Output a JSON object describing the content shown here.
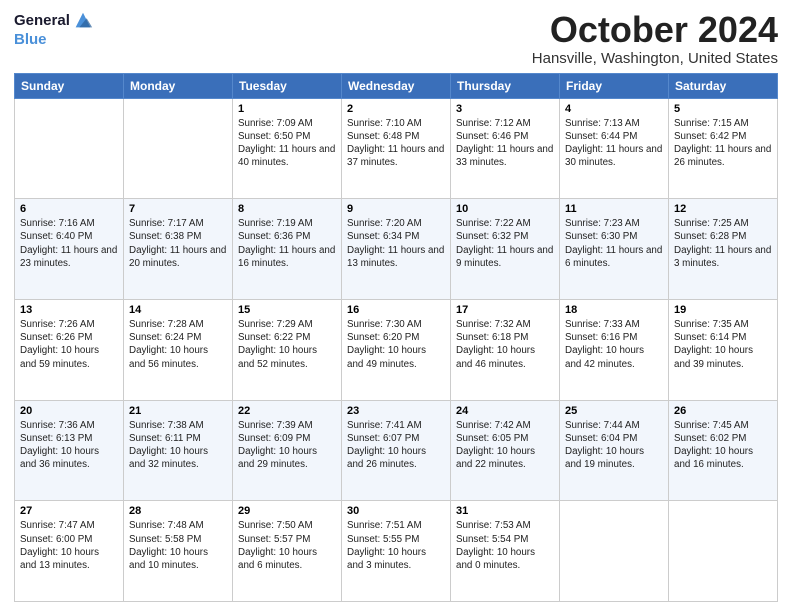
{
  "header": {
    "logo_line1": "General",
    "logo_line2": "Blue",
    "title": "October 2024",
    "subtitle": "Hansville, Washington, United States"
  },
  "weekdays": [
    "Sunday",
    "Monday",
    "Tuesday",
    "Wednesday",
    "Thursday",
    "Friday",
    "Saturday"
  ],
  "weeks": [
    [
      {
        "day": "",
        "info": ""
      },
      {
        "day": "",
        "info": ""
      },
      {
        "day": "1",
        "info": "Sunrise: 7:09 AM\nSunset: 6:50 PM\nDaylight: 11 hours and 40 minutes."
      },
      {
        "day": "2",
        "info": "Sunrise: 7:10 AM\nSunset: 6:48 PM\nDaylight: 11 hours and 37 minutes."
      },
      {
        "day": "3",
        "info": "Sunrise: 7:12 AM\nSunset: 6:46 PM\nDaylight: 11 hours and 33 minutes."
      },
      {
        "day": "4",
        "info": "Sunrise: 7:13 AM\nSunset: 6:44 PM\nDaylight: 11 hours and 30 minutes."
      },
      {
        "day": "5",
        "info": "Sunrise: 7:15 AM\nSunset: 6:42 PM\nDaylight: 11 hours and 26 minutes."
      }
    ],
    [
      {
        "day": "6",
        "info": "Sunrise: 7:16 AM\nSunset: 6:40 PM\nDaylight: 11 hours and 23 minutes."
      },
      {
        "day": "7",
        "info": "Sunrise: 7:17 AM\nSunset: 6:38 PM\nDaylight: 11 hours and 20 minutes."
      },
      {
        "day": "8",
        "info": "Sunrise: 7:19 AM\nSunset: 6:36 PM\nDaylight: 11 hours and 16 minutes."
      },
      {
        "day": "9",
        "info": "Sunrise: 7:20 AM\nSunset: 6:34 PM\nDaylight: 11 hours and 13 minutes."
      },
      {
        "day": "10",
        "info": "Sunrise: 7:22 AM\nSunset: 6:32 PM\nDaylight: 11 hours and 9 minutes."
      },
      {
        "day": "11",
        "info": "Sunrise: 7:23 AM\nSunset: 6:30 PM\nDaylight: 11 hours and 6 minutes."
      },
      {
        "day": "12",
        "info": "Sunrise: 7:25 AM\nSunset: 6:28 PM\nDaylight: 11 hours and 3 minutes."
      }
    ],
    [
      {
        "day": "13",
        "info": "Sunrise: 7:26 AM\nSunset: 6:26 PM\nDaylight: 10 hours and 59 minutes."
      },
      {
        "day": "14",
        "info": "Sunrise: 7:28 AM\nSunset: 6:24 PM\nDaylight: 10 hours and 56 minutes."
      },
      {
        "day": "15",
        "info": "Sunrise: 7:29 AM\nSunset: 6:22 PM\nDaylight: 10 hours and 52 minutes."
      },
      {
        "day": "16",
        "info": "Sunrise: 7:30 AM\nSunset: 6:20 PM\nDaylight: 10 hours and 49 minutes."
      },
      {
        "day": "17",
        "info": "Sunrise: 7:32 AM\nSunset: 6:18 PM\nDaylight: 10 hours and 46 minutes."
      },
      {
        "day": "18",
        "info": "Sunrise: 7:33 AM\nSunset: 6:16 PM\nDaylight: 10 hours and 42 minutes."
      },
      {
        "day": "19",
        "info": "Sunrise: 7:35 AM\nSunset: 6:14 PM\nDaylight: 10 hours and 39 minutes."
      }
    ],
    [
      {
        "day": "20",
        "info": "Sunrise: 7:36 AM\nSunset: 6:13 PM\nDaylight: 10 hours and 36 minutes."
      },
      {
        "day": "21",
        "info": "Sunrise: 7:38 AM\nSunset: 6:11 PM\nDaylight: 10 hours and 32 minutes."
      },
      {
        "day": "22",
        "info": "Sunrise: 7:39 AM\nSunset: 6:09 PM\nDaylight: 10 hours and 29 minutes."
      },
      {
        "day": "23",
        "info": "Sunrise: 7:41 AM\nSunset: 6:07 PM\nDaylight: 10 hours and 26 minutes."
      },
      {
        "day": "24",
        "info": "Sunrise: 7:42 AM\nSunset: 6:05 PM\nDaylight: 10 hours and 22 minutes."
      },
      {
        "day": "25",
        "info": "Sunrise: 7:44 AM\nSunset: 6:04 PM\nDaylight: 10 hours and 19 minutes."
      },
      {
        "day": "26",
        "info": "Sunrise: 7:45 AM\nSunset: 6:02 PM\nDaylight: 10 hours and 16 minutes."
      }
    ],
    [
      {
        "day": "27",
        "info": "Sunrise: 7:47 AM\nSunset: 6:00 PM\nDaylight: 10 hours and 13 minutes."
      },
      {
        "day": "28",
        "info": "Sunrise: 7:48 AM\nSunset: 5:58 PM\nDaylight: 10 hours and 10 minutes."
      },
      {
        "day": "29",
        "info": "Sunrise: 7:50 AM\nSunset: 5:57 PM\nDaylight: 10 hours and 6 minutes."
      },
      {
        "day": "30",
        "info": "Sunrise: 7:51 AM\nSunset: 5:55 PM\nDaylight: 10 hours and 3 minutes."
      },
      {
        "day": "31",
        "info": "Sunrise: 7:53 AM\nSunset: 5:54 PM\nDaylight: 10 hours and 0 minutes."
      },
      {
        "day": "",
        "info": ""
      },
      {
        "day": "",
        "info": ""
      }
    ]
  ]
}
